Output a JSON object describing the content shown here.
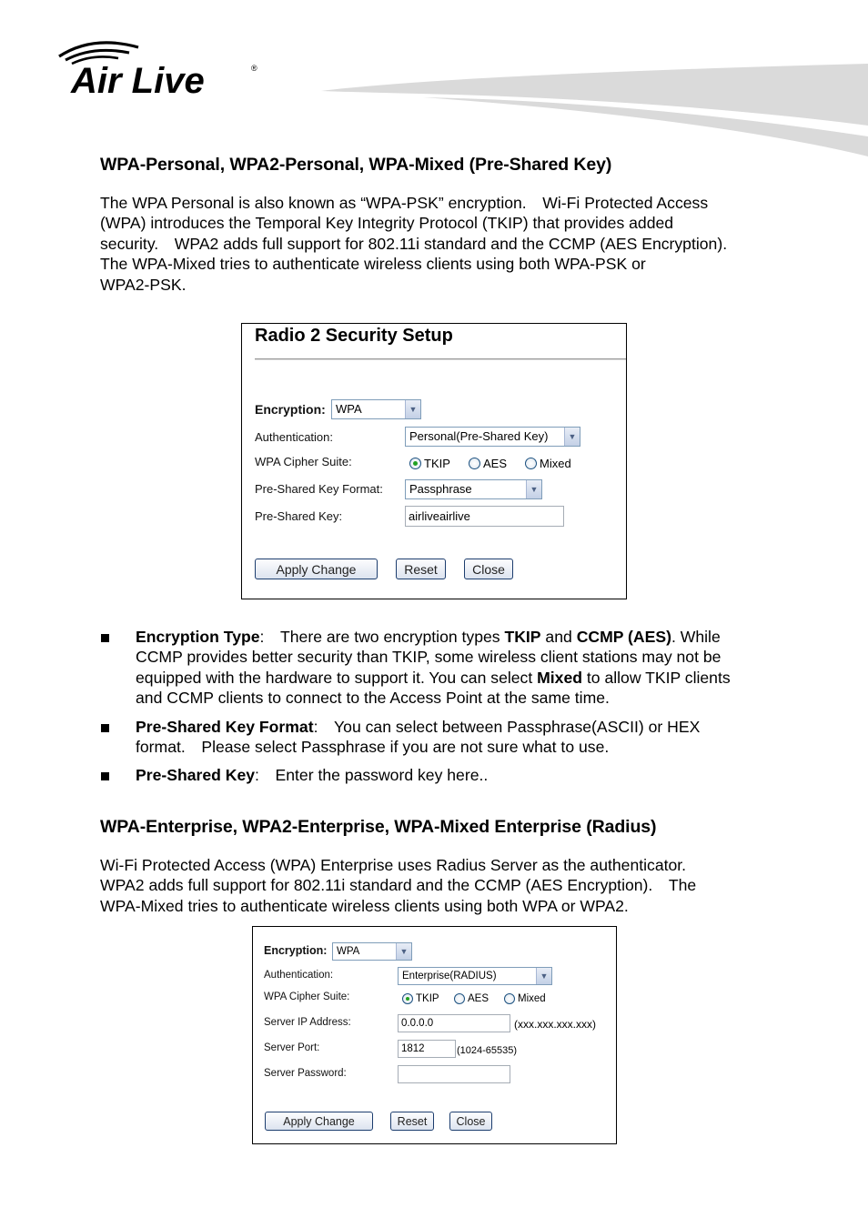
{
  "header": {
    "logo_text": "Air Live",
    "logo_mark": "®"
  },
  "section1": {
    "heading": "WPA-Personal, WPA2-Personal, WPA-Mixed (Pre-Shared Key)",
    "paragraph_lines": [
      "The WPA Personal is also known as “WPA-PSK” encryption. Wi-Fi Protected Access",
      "(WPA) introduces the Temporal Key Integrity Protocol (TKIP) that provides added",
      "security. WPA2 adds full support for 802.11i standard and the CCMP (AES Encryption).",
      "The WPA-Mixed tries to authenticate wireless clients using both WPA-PSK or",
      "WPA2-PSK."
    ]
  },
  "panel1": {
    "title": "Radio 2 Security Setup",
    "encryption_label": "Encryption:",
    "encryption_value": "WPA",
    "authentication_label": "Authentication:",
    "authentication_value": "Personal(Pre-Shared Key)",
    "cipher_label": "WPA Cipher Suite:",
    "cipher_options": [
      "TKIP",
      "AES",
      "Mixed"
    ],
    "cipher_selected": "TKIP",
    "psk_format_label": "Pre-Shared Key Format:",
    "psk_format_value": "Passphrase",
    "psk_label": "Pre-Shared Key:",
    "psk_value": "airliveairlive",
    "apply_label": "Apply Change",
    "reset_label": "Reset",
    "close_label": "Close"
  },
  "bullets": [
    {
      "lines": [
        [
          {
            "b": "Encryption Type"
          },
          {
            "t": ": There are two encryption types "
          },
          {
            "b": "TKIP"
          },
          {
            "t": " and "
          },
          {
            "b": "CCMP (AES)"
          },
          {
            "t": ". While"
          }
        ],
        [
          {
            "t": "CCMP provides better security than TKIP, some wireless client stations may not be"
          }
        ],
        [
          {
            "t": "equipped with the hardware to support it. You can select "
          },
          {
            "b": "Mixed"
          },
          {
            "t": " to allow TKIP clients"
          }
        ],
        [
          {
            "t": "and CCMP clients to connect to the Access Point at the same time."
          }
        ]
      ]
    },
    {
      "lines": [
        [
          {
            "b": "Pre-Shared Key Format"
          },
          {
            "t": ": You can select between Passphrase(ASCII) or HEX"
          }
        ],
        [
          {
            "t": "format. Please select Passphrase if you are not sure what to use."
          }
        ]
      ]
    },
    {
      "lines": [
        [
          {
            "b": "Pre-Shared Key"
          },
          {
            "t": ": Enter the password key here.."
          }
        ]
      ]
    }
  ],
  "section2": {
    "heading": "WPA-Enterprise, WPA2-Enterprise, WPA-Mixed Enterprise (Radius)",
    "paragraph_lines": [
      "Wi-Fi Protected Access (WPA) Enterprise uses Radius Server as the authenticator.",
      "WPA2 adds full support for 802.11i standard and the CCMP (AES Encryption). The",
      "WPA-Mixed tries to authenticate wireless clients using both WPA or WPA2."
    ]
  },
  "panel2": {
    "encryption_label": "Encryption:",
    "encryption_value": "WPA",
    "authentication_label": "Authentication:",
    "authentication_value": "Enterprise(RADIUS)",
    "cipher_label": "WPA Cipher Suite:",
    "cipher_options": [
      "TKIP",
      "AES",
      "Mixed"
    ],
    "cipher_selected": "TKIP",
    "server_ip_label": "Server IP Address:",
    "server_ip_value": "0.0.0.0",
    "server_ip_hint": "(xxx.xxx.xxx.xxx)",
    "server_port_label": "Server Port:",
    "server_port_value": "1812",
    "server_port_hint": "(1024-65535)",
    "server_password_label": "Server Password:",
    "server_password_value": "",
    "apply_label": "Apply Change",
    "reset_label": "Reset",
    "close_label": "Close"
  }
}
